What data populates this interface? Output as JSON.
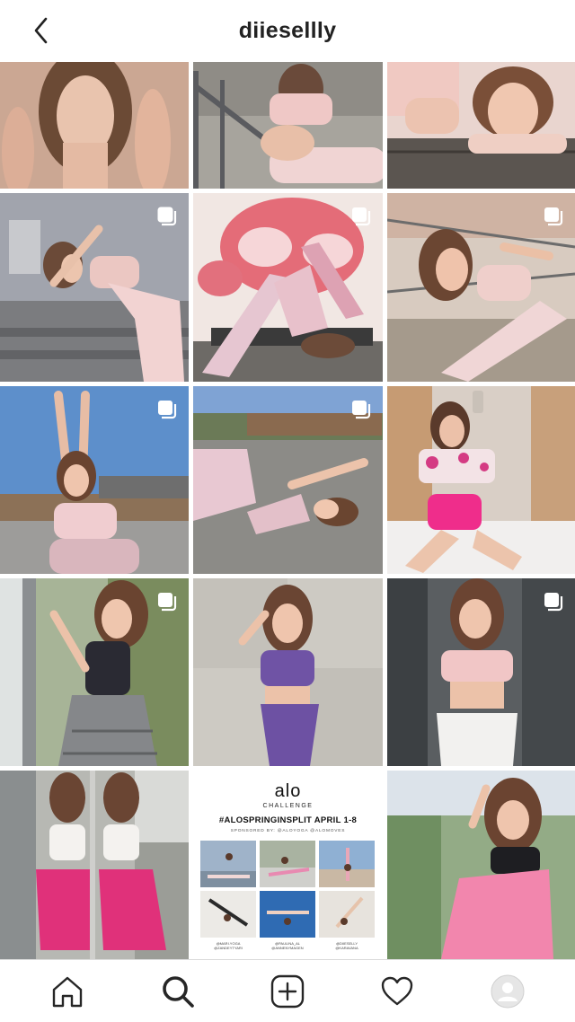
{
  "header": {
    "title": "diiesellly"
  },
  "grid": {
    "columns": 3,
    "posts": [
      {
        "id": "post-1",
        "multi": false,
        "bg": "#c9a58f"
      },
      {
        "id": "post-2",
        "multi": false,
        "bg": "#9b9890"
      },
      {
        "id": "post-3",
        "multi": false,
        "bg": "#e7c9c0"
      },
      {
        "id": "post-4",
        "multi": true,
        "bg": "#a8aab3"
      },
      {
        "id": "post-5",
        "multi": true,
        "bg": "#e6a4a6"
      },
      {
        "id": "post-6",
        "multi": true,
        "bg": "#c6b8ad"
      },
      {
        "id": "post-7",
        "multi": true,
        "bg": "#5f8dc4"
      },
      {
        "id": "post-8",
        "multi": true,
        "bg": "#8faed1"
      },
      {
        "id": "post-9",
        "multi": false,
        "bg": "#d8c7b8"
      },
      {
        "id": "post-10",
        "multi": true,
        "bg": "#8a9a77"
      },
      {
        "id": "post-11",
        "multi": false,
        "bg": "#c8c5bd"
      },
      {
        "id": "post-12",
        "multi": true,
        "bg": "#5c6063"
      },
      {
        "id": "post-13",
        "multi": false,
        "bg": "#b9b5ad"
      },
      {
        "id": "post-14",
        "multi": false,
        "bg": "#ffffff"
      },
      {
        "id": "post-15",
        "multi": false,
        "bg": "#7c9a72"
      }
    ]
  },
  "alo_challenge": {
    "logo": "alo",
    "subtitle": "CHALLENGE",
    "headline": "#ALOSPRINGINSPLIT APRIL 1-8",
    "sponsor": "SPONSORED BY: @ALOYOGA @ALOMOVES",
    "captions": [
      "@MARI.YOGA\n@ZANDEYTYARI",
      "@PAULINA_AL\n@ANNENYMAGEN",
      "@DIIESELLY\n@KARAVANA"
    ]
  },
  "bottom_nav": {
    "items": [
      "home",
      "search",
      "new-post",
      "activity",
      "profile"
    ],
    "active": "search"
  },
  "colors": {
    "header_text": "#222222",
    "nav_icon": "#262626",
    "divider": "#dbdbdb"
  }
}
